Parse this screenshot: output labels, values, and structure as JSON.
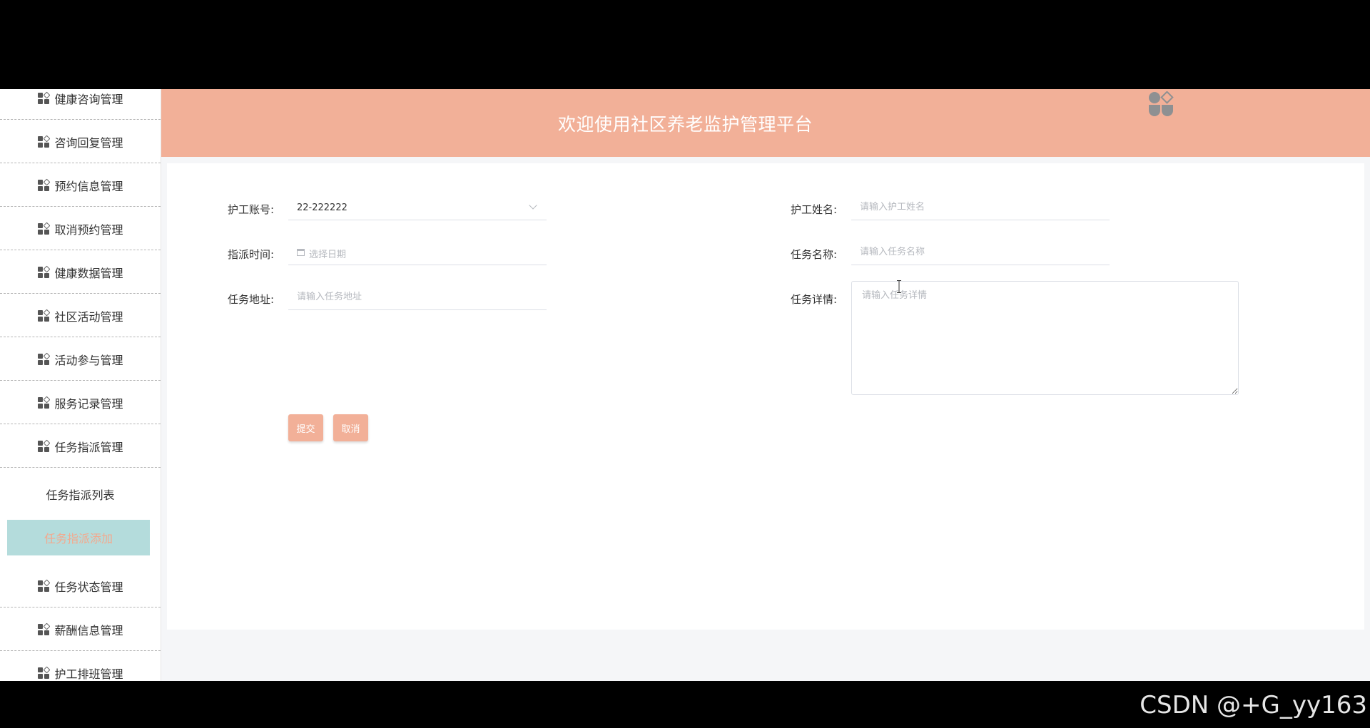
{
  "header": {
    "title": "欢迎使用社区养老监护管理平台"
  },
  "sidebar": {
    "items": [
      {
        "label": "健康咨询管理"
      },
      {
        "label": "咨询回复管理"
      },
      {
        "label": "预约信息管理"
      },
      {
        "label": "取消预约管理"
      },
      {
        "label": "健康数据管理"
      },
      {
        "label": "社区活动管理"
      },
      {
        "label": "活动参与管理"
      },
      {
        "label": "服务记录管理"
      },
      {
        "label": "任务指派管理"
      }
    ],
    "sub_items": [
      {
        "label": "任务指派列表"
      },
      {
        "label": "任务指派添加",
        "active": true
      }
    ],
    "items_after": [
      {
        "label": "任务状态管理"
      },
      {
        "label": "薪酬信息管理"
      },
      {
        "label": "护工排班管理"
      }
    ]
  },
  "form": {
    "account": {
      "label": "护工账号:",
      "value": "22-222222"
    },
    "name": {
      "label": "护工姓名:",
      "placeholder": "请输入护工姓名"
    },
    "time": {
      "label": "指派时间:",
      "placeholder": "选择日期"
    },
    "task_name": {
      "label": "任务名称:",
      "placeholder": "请输入任务名称"
    },
    "address": {
      "label": "任务地址:",
      "placeholder": "请输入任务地址"
    },
    "details": {
      "label": "任务详情:",
      "placeholder": "请输入任务详情"
    },
    "submit_label": "提交",
    "cancel_label": "取消"
  },
  "watermark": "CSDN @+G_yy163",
  "colors": {
    "accent": "#f2b098",
    "active_bg": "#b4dcdc",
    "active_text": "#f3a98e"
  }
}
